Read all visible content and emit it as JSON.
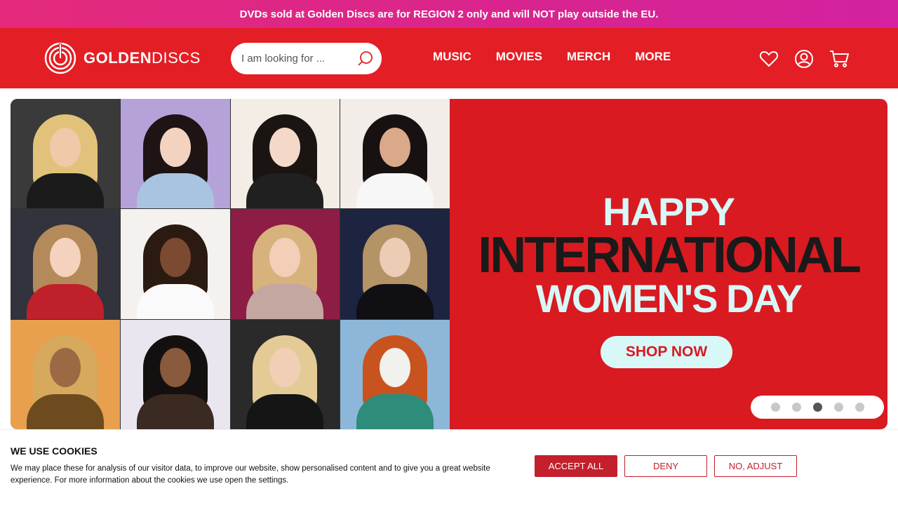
{
  "announcement": "DVDs sold at Golden Discs are for REGION 2 only and will NOT play outside the EU.",
  "header": {
    "logo_bold": "GOLDEN",
    "logo_light": "DISCS",
    "search_placeholder": "I am looking for ...",
    "nav": [
      "MUSIC",
      "MOVIES",
      "MERCH",
      "MORE"
    ],
    "icons": [
      "heart-icon",
      "account-icon",
      "cart-icon"
    ],
    "brand_color": "#e31e24"
  },
  "hero": {
    "line1": "HAPPY",
    "line2": "INTERNATIONAL",
    "line3": "WOMEN'S DAY",
    "cta": "SHOP NOW",
    "slides_total": 5,
    "active_slide": 3
  },
  "cookies": {
    "title": "WE USE COOKIES",
    "text": "We may place these for analysis of our visitor data, to improve our website, show personalised content and to give you a great website experience. For more information about the cookies we use open the settings.",
    "accept": "ACCEPT ALL",
    "deny": "DENY",
    "adjust": "NO, ADJUST",
    "accent": "#c41f2c"
  }
}
